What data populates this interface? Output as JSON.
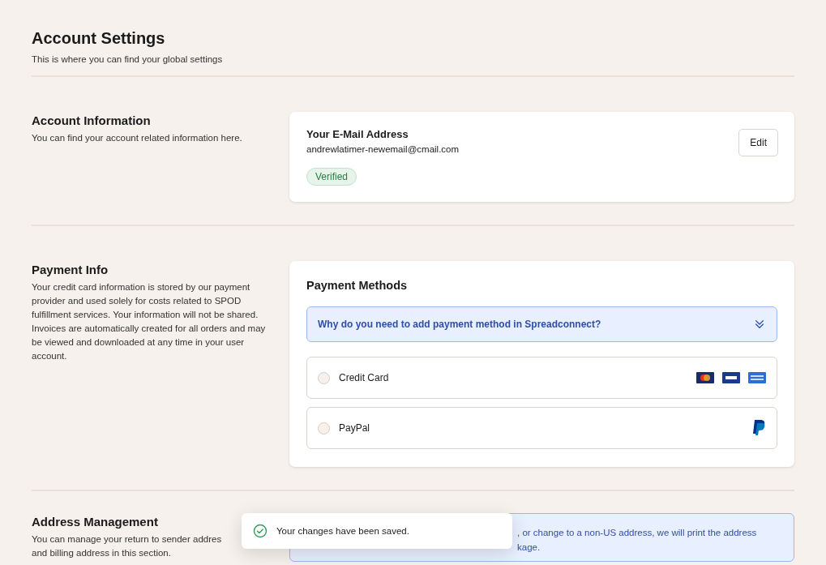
{
  "header": {
    "title": "Account Settings",
    "subtitle": "This is where you can find your global settings"
  },
  "account_information": {
    "title": "Account Information",
    "description": "You can find your account related information here.",
    "card": {
      "title": "Your E-Mail Address",
      "email": "andrewlatimer-newemail@cmail.com",
      "badge": "Verified",
      "edit_button": "Edit"
    }
  },
  "payment_info": {
    "title": "Payment Info",
    "description": "Your credit card information is stored by our payment provider and used solely for costs related to SPOD fulfillment services. Your information will not be shared. Invoices are automatically created for all orders and may be viewed and downloaded at any time in your user account.",
    "card": {
      "title": "Payment Methods",
      "accordion": {
        "label": "Why do you need to add payment method in Spreadconnect?",
        "expanded": false
      },
      "methods": [
        {
          "label": "Credit Card",
          "selected": false,
          "kind": "cards"
        },
        {
          "label": "PayPal",
          "selected": false,
          "kind": "paypal"
        }
      ]
    }
  },
  "address_management": {
    "title": "Address Management",
    "description_lines": [
      "You can manage your return to sender addres",
      "and billing address in this section."
    ],
    "notice_lines": [
      ", or change to a non-US address, we will print the address",
      "kage."
    ]
  },
  "toast": {
    "message": "Your changes have been saved."
  }
}
